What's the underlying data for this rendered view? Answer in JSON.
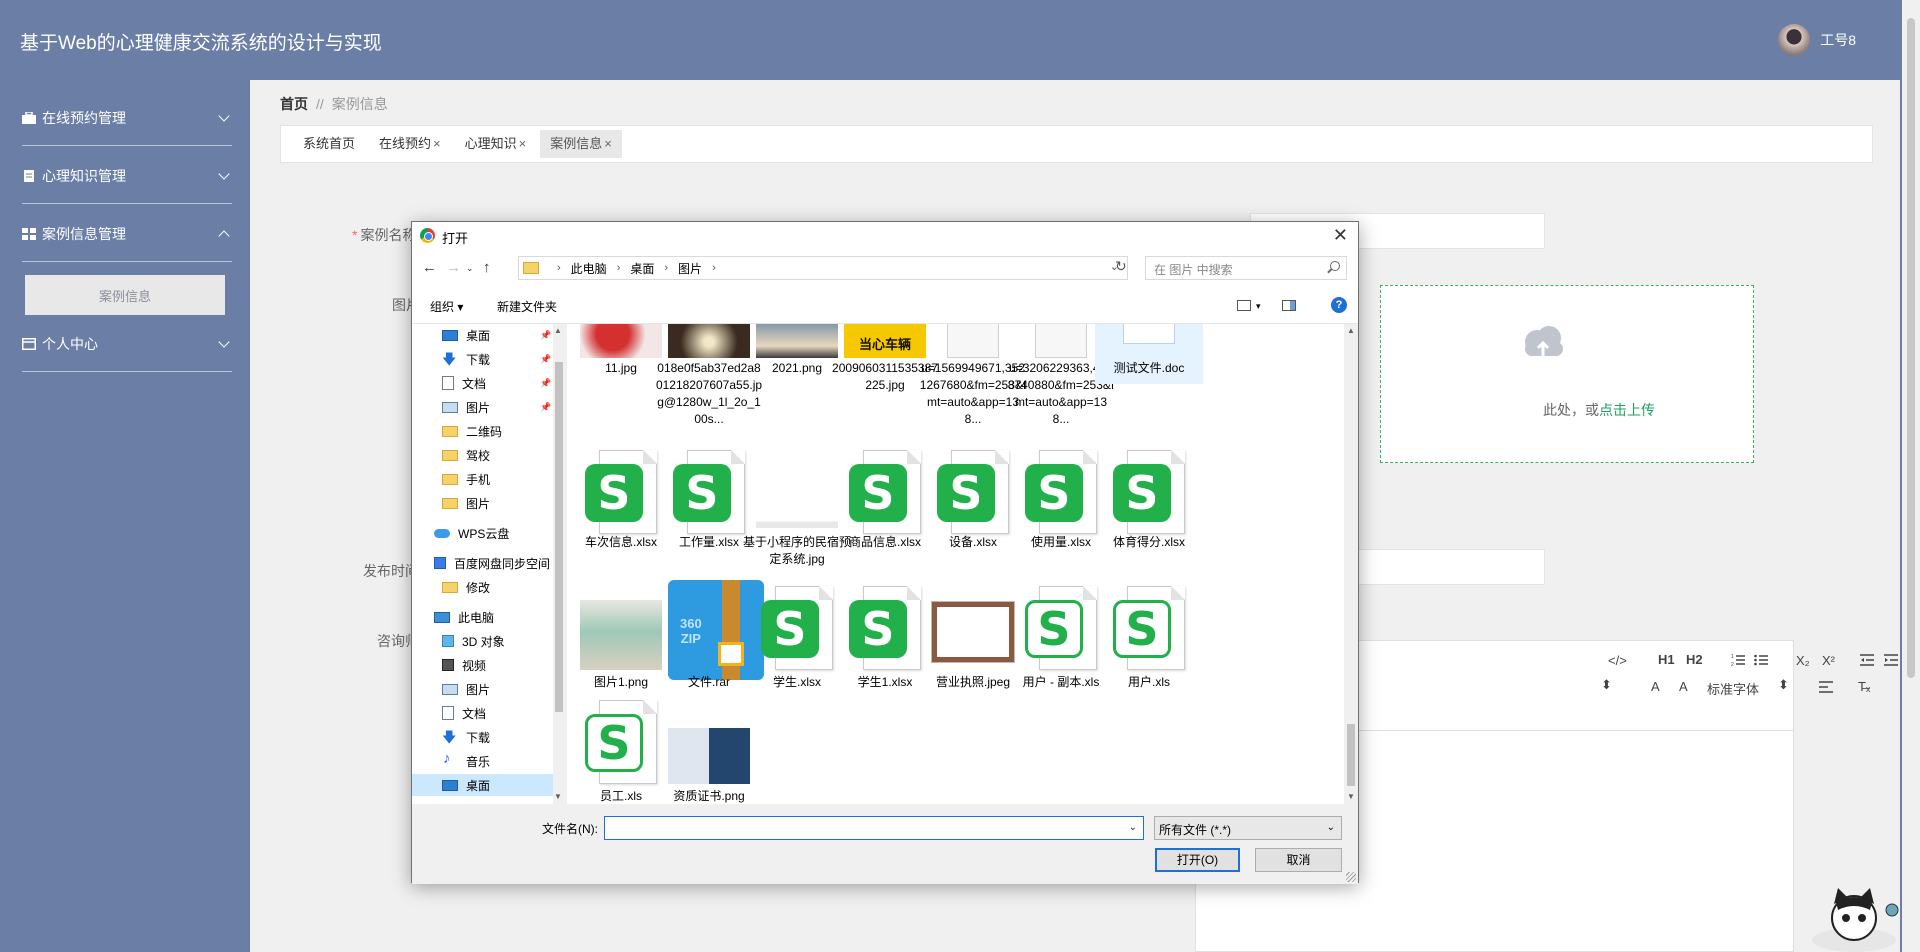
{
  "app": {
    "title": "基于Web的心理健康交流系统的设计与实现",
    "user": "工号8"
  },
  "sidebar": {
    "items": [
      {
        "label": "在线预约管理",
        "icon": "briefcase-icon"
      },
      {
        "label": "心理知识管理",
        "icon": "document-icon"
      },
      {
        "label": "案例信息管理",
        "icon": "grid-icon",
        "expanded": true
      },
      {
        "label": "个人中心",
        "icon": "window-icon"
      }
    ],
    "sub_item": "案例信息"
  },
  "breadcrumb": {
    "home": "首页",
    "sep": "//",
    "current": "案例信息"
  },
  "tabs": [
    {
      "label": "系统首页",
      "close": ""
    },
    {
      "label": "在线预约",
      "close": "×"
    },
    {
      "label": "心理知识",
      "close": "×"
    },
    {
      "label": "案例信息",
      "close": "×"
    }
  ],
  "form": {
    "name_label": "案例名称",
    "image_label": "图片",
    "publish_label": "发布时间",
    "consult_label": "咨询师",
    "required_mark": "*",
    "upload_hint": "将文件拖到此处，或",
    "upload_hint_visible": "此处，或",
    "upload_link": "点击上传"
  },
  "editor": {
    "code": "</>",
    "h1": "H1",
    "h2": "H2",
    "sub": "X₂",
    "sup": "X²",
    "font": "标准字体",
    "clear": "T̶ₓ"
  },
  "dialog": {
    "title": "打开",
    "close": "✕",
    "path": [
      "此电脑",
      "桌面",
      "图片"
    ],
    "search_placeholder": "在 图片 中搜索",
    "organize": "组织 ▾",
    "new_folder": "新建文件夹",
    "help": "?",
    "nav": [
      {
        "label": "桌面",
        "icon": "desktop-icon",
        "pinned": true
      },
      {
        "label": "下载",
        "icon": "download-icon",
        "pinned": true
      },
      {
        "label": "文档",
        "icon": "document-icon",
        "pinned": true
      },
      {
        "label": "图片",
        "icon": "pictures-icon",
        "pinned": true
      },
      {
        "label": "二维码",
        "icon": "folder-icon"
      },
      {
        "label": "驾校",
        "icon": "folder-icon"
      },
      {
        "label": "手机",
        "icon": "folder-icon"
      },
      {
        "label": "图片",
        "icon": "folder-icon"
      },
      {
        "label": "WPS云盘",
        "icon": "cloud-icon"
      },
      {
        "label": "百度网盘同步空间",
        "icon": "baidu-icon"
      },
      {
        "label": "修改",
        "icon": "folder-icon"
      },
      {
        "label": "此电脑",
        "icon": "pc-icon"
      },
      {
        "label": "3D 对象",
        "icon": "3d-icon"
      },
      {
        "label": "视频",
        "icon": "video-icon"
      },
      {
        "label": "图片",
        "icon": "pictures-icon"
      },
      {
        "label": "文档",
        "icon": "document-icon"
      },
      {
        "label": "下载",
        "icon": "download-icon"
      },
      {
        "label": "音乐",
        "icon": "music-icon"
      },
      {
        "label": "桌面",
        "icon": "desktop-icon",
        "selected": true
      }
    ],
    "pin_glyph": "📌",
    "files": [
      {
        "name": "11.jpg",
        "kind": "photo-red"
      },
      {
        "name": "018e0f5ab37ed2a801218207607a55.jpg@1280w_1l_2o_100s...",
        "kind": "photo-dark"
      },
      {
        "name": "2021.png",
        "kind": "photo-sky"
      },
      {
        "name": "2009060311535387225.jpg",
        "kind": "photo-sign",
        "sign_text": "当心车辆"
      },
      {
        "name": "u=1569949671,3521267680&fm=253&fmt=auto&app=138...",
        "kind": "blank-image"
      },
      {
        "name": "u=3206229363,4098740880&fm=253&fmt=auto&app=138...",
        "kind": "blank-image"
      },
      {
        "name": "测试文件.doc",
        "kind": "doc",
        "selected": true
      },
      {
        "name": "车次信息.xlsx",
        "kind": "xls"
      },
      {
        "name": "工作量.xlsx",
        "kind": "xls"
      },
      {
        "name": "基于小程序的民宿预定系统.jpg",
        "kind": "blank"
      },
      {
        "name": "商品信息.xlsx",
        "kind": "xls"
      },
      {
        "name": "设备.xlsx",
        "kind": "xls"
      },
      {
        "name": "使用量.xlsx",
        "kind": "xls"
      },
      {
        "name": "体育得分.xlsx",
        "kind": "xls"
      },
      {
        "name": "图片1.png",
        "kind": "photo-room"
      },
      {
        "name": "文件.rar",
        "kind": "zip"
      },
      {
        "name": "学生.xlsx",
        "kind": "xls"
      },
      {
        "name": "学生1.xlsx",
        "kind": "xls"
      },
      {
        "name": "营业执照.jpeg",
        "kind": "photo-cert"
      },
      {
        "name": "用户 - 副本.xls",
        "kind": "xls-outline"
      },
      {
        "name": "用户.xls",
        "kind": "xls-outline"
      },
      {
        "name": "员工.xls",
        "kind": "xls-outline"
      },
      {
        "name": "资质证书.png",
        "kind": "photo-cert2"
      }
    ],
    "xls_glyph": "S",
    "filename_label": "文件名(N):",
    "filename_value": "",
    "filetype": "所有文件 (*.*)",
    "open_button": "打开(O)",
    "cancel_button": "取消"
  },
  "colors": {
    "header": "#6b7fa6",
    "accent_green": "#20a060",
    "dialog_blue": "#1e6fd6",
    "xls_green": "#22b04b"
  }
}
